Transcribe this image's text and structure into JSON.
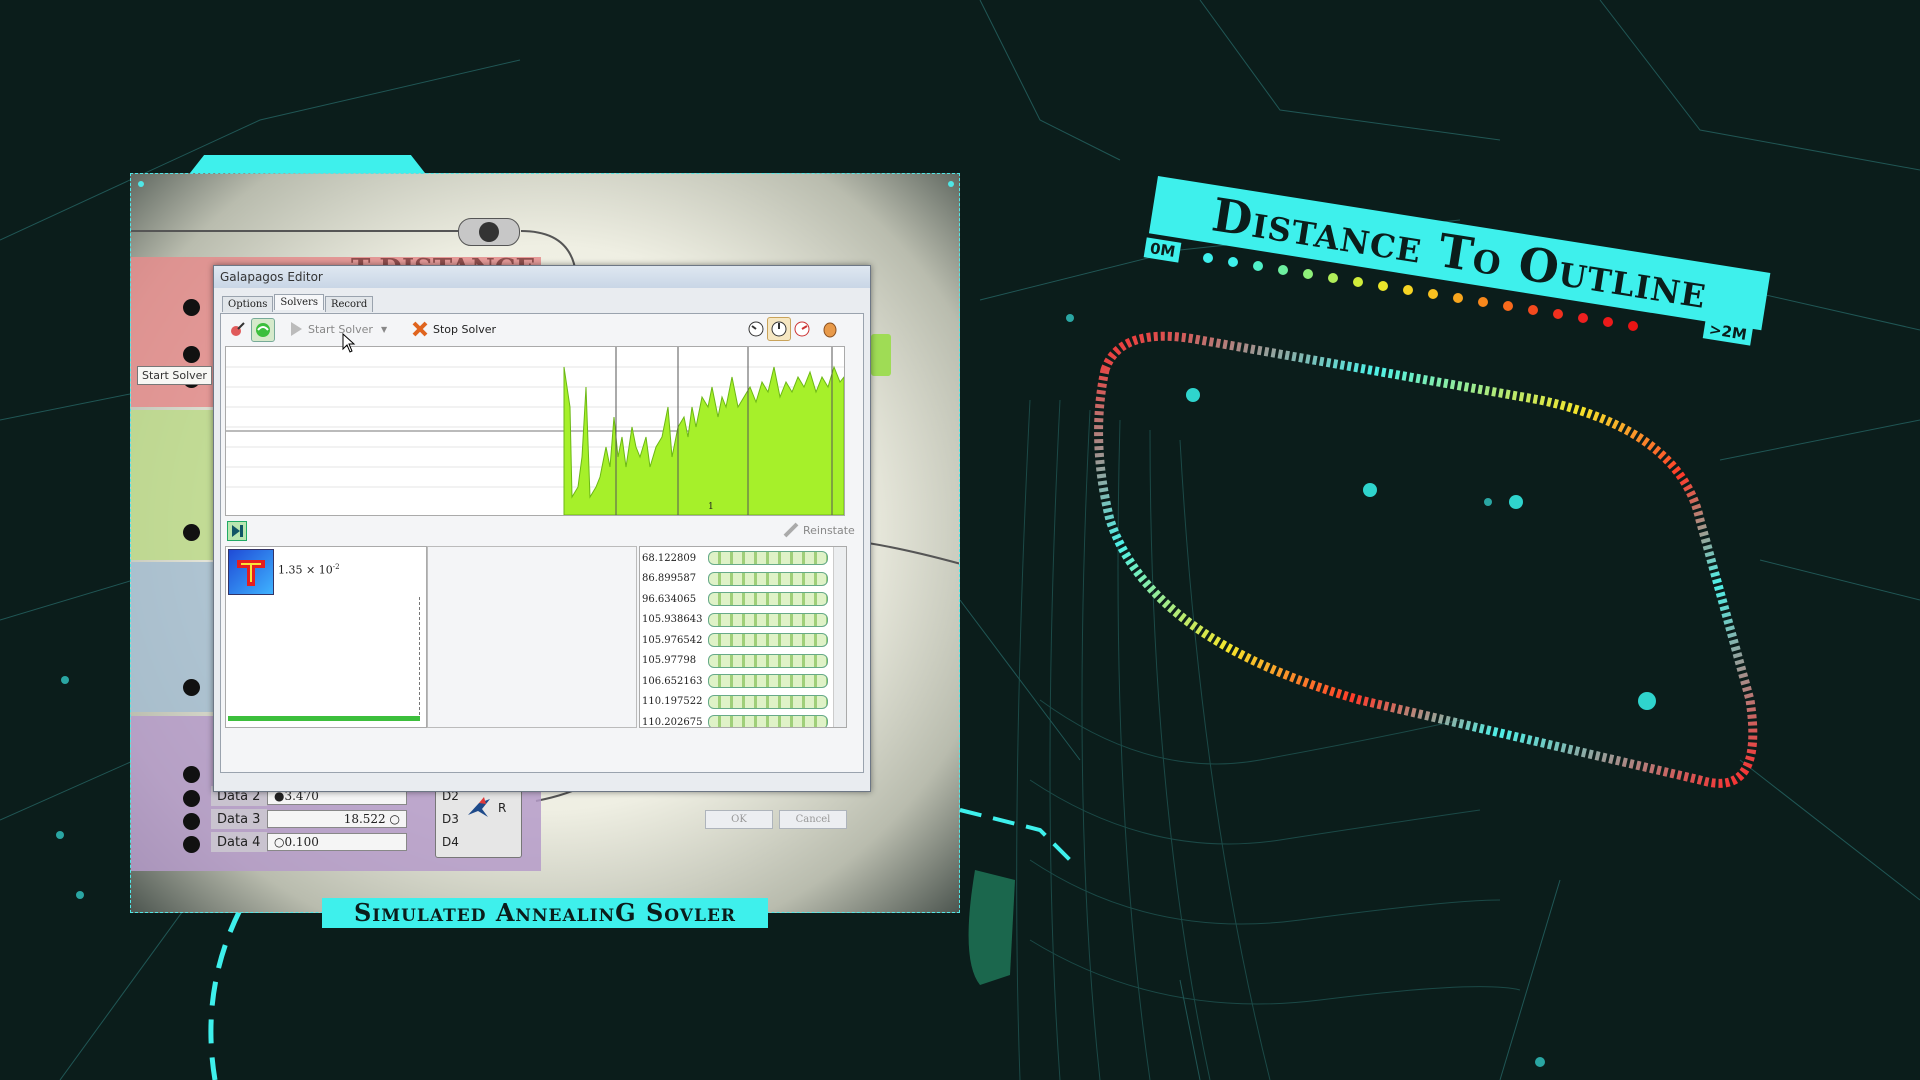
{
  "window": {
    "title": "Galapagos Editor",
    "tabs": [
      "Options",
      "Solvers",
      "Record"
    ],
    "active_tab": "Solvers",
    "start_solver": "Start Solver",
    "stop_solver": "Stop Solver",
    "tooltip": "Start Solver",
    "graph_marker": "1",
    "reinstate": "Reinstate",
    "genome_value": "1.35 × 10",
    "genome_exp": "-2",
    "ok": "OK",
    "cancel": "Cancel"
  },
  "fitness_values": [
    "68.122809",
    "86.899587",
    "96.634065",
    "105.938643",
    "105.976542",
    "105.97798",
    "106.652163",
    "110.197522",
    "110.202675"
  ],
  "gh_background": {
    "title_fragment": "T DISTANCE",
    "sliders": [
      {
        "label": "Data 2",
        "value": "3.470",
        "port": "D2"
      },
      {
        "label": "Data 3",
        "value": "18.522",
        "port": "D3"
      },
      {
        "label": "Data 4",
        "value": "0.100",
        "port": "D4"
      }
    ],
    "output_port": "R"
  },
  "captions": {
    "solver": "Simulated AnnealinG Sovler",
    "distance_title": "Distance To Outline",
    "min_tag": "0M",
    "max_tag": ">2M"
  },
  "colors": {
    "accent": "#3ef0ec",
    "background": "#0b1d1b",
    "fitness_fill": "#a6f02a"
  }
}
